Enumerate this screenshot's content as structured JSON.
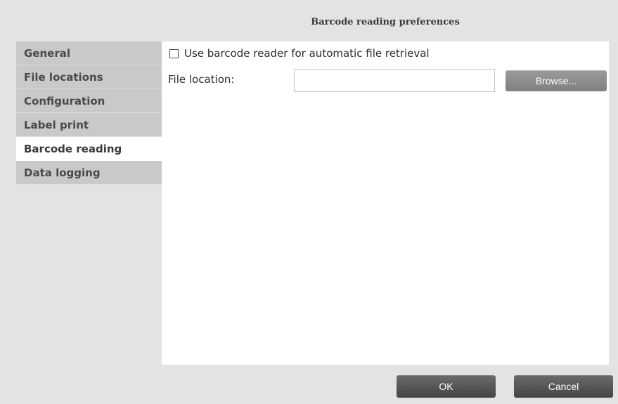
{
  "dialog": {
    "title": "Barcode reading preferences"
  },
  "sidebar": {
    "items": [
      {
        "label": "General",
        "active": false
      },
      {
        "label": "File locations",
        "active": false
      },
      {
        "label": "Configuration",
        "active": false
      },
      {
        "label": "Label print",
        "active": false
      },
      {
        "label": "Barcode reading",
        "active": true
      },
      {
        "label": "Data logging",
        "active": false
      }
    ]
  },
  "main": {
    "checkbox_label": "Use barcode reader for automatic file retrieval",
    "checkbox_checked": false,
    "file_location_label": "File location:",
    "file_location_value": "",
    "browse_label": "Browse..."
  },
  "footer": {
    "ok_label": "OK",
    "cancel_label": "Cancel"
  },
  "colors": {
    "background": "#e3e3e3",
    "sidebar_item": "#c9c9c9",
    "active_item": "#ffffff",
    "button_dark": "#555555",
    "button_light": "#8d8d8d"
  }
}
